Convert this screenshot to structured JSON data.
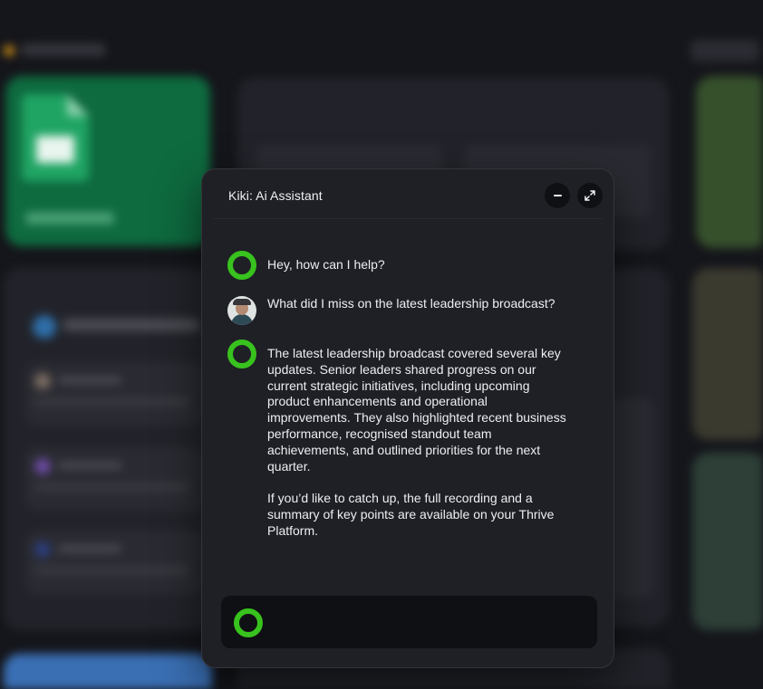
{
  "assistant": {
    "title": "Kiki: Ai Assistant",
    "controls": {
      "minimize_icon": "minus-icon",
      "expand_icon": "expand-arrows-icon"
    }
  },
  "conversation": [
    {
      "role": "assistant",
      "avatar": "green-ring-icon",
      "text": "Hey, how can I help?"
    },
    {
      "role": "user",
      "avatar": "user-photo",
      "text": "What did I miss on the latest leadership broadcast?"
    },
    {
      "role": "assistant",
      "avatar": "green-ring-icon",
      "text": "The latest leadership broadcast covered several key updates. Senior leaders shared progress on our current strategic initiatives, including upcoming product enhancements and operational improvements. They also highlighted recent business performance, recognised standout team achievements, and outlined priorities for the next quarter.\n\nIf you’d like to catch up, the full recording and a summary of key points are available on your Thrive Platform."
    }
  ],
  "composer": {
    "value": "",
    "placeholder": "",
    "icon": "green-ring-icon"
  },
  "colors": {
    "panel": "#1f2025",
    "accent_ring": "#38c21e",
    "input_bg": "#0f1013",
    "backdrop": "#15161b"
  }
}
